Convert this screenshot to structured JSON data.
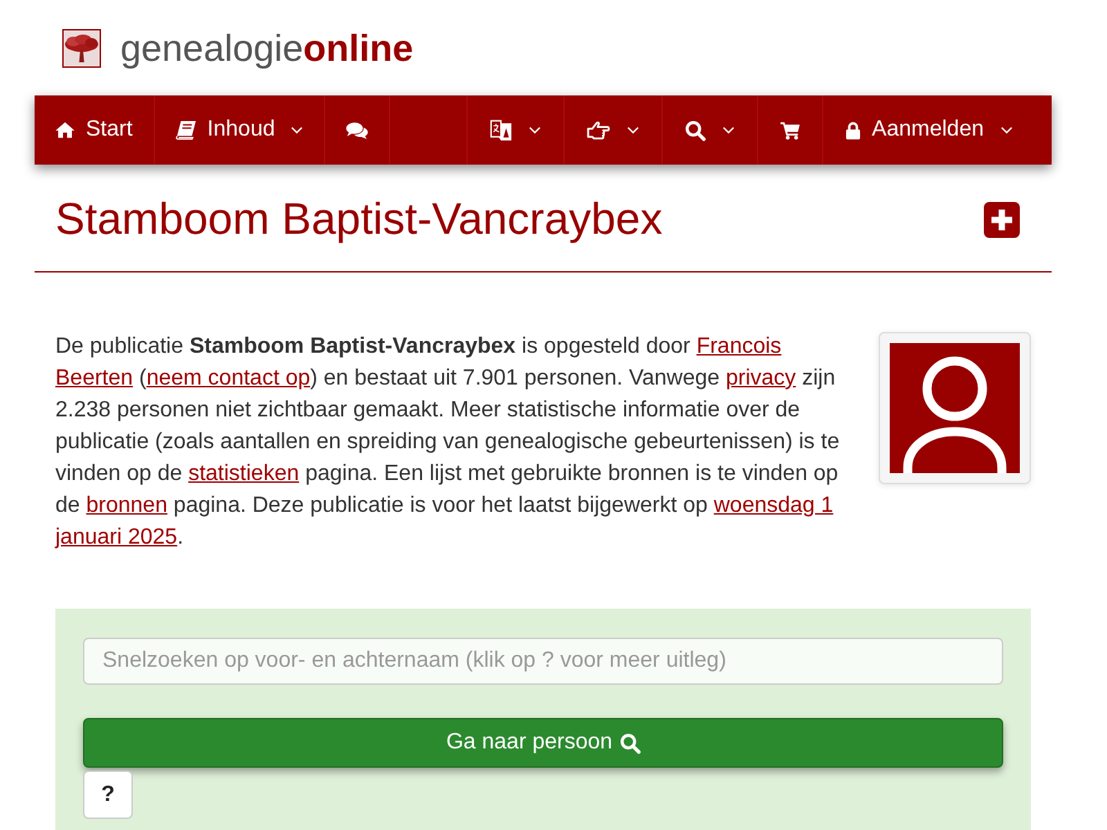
{
  "logo": {
    "text": "genealogie**online**"
  },
  "nav": {
    "left": [
      {
        "label": "Start",
        "dropdown": false
      },
      {
        "label": "Inhoud",
        "dropdown": true
      },
      {
        "dropdown": false
      }
    ],
    "right": [
      {
        "dropdown": true
      },
      {
        "dropdown": true
      },
      {
        "dropdown": true
      },
      {
        "dropdown": false
      },
      {
        "label": "Aanmelden",
        "dropdown": true
      }
    ]
  },
  "page": {
    "title": "Stamboom Baptist-Vancraybex"
  },
  "intro": [
    {
      "kind": "text",
      "text": "De publicatie **Stamboom Baptist-Vancraybex** is opgesteld door "
    },
    {
      "kind": "link",
      "lines": [
        "Francois",
        "Beerten"
      ]
    },
    {
      "kind": "text",
      "text": " ("
    },
    {
      "kind": "link",
      "lines": [
        "neem contact op"
      ]
    },
    {
      "kind": "text",
      "text": ") en bestaat uit 7.901 personen. Vanwege "
    },
    {
      "kind": "link",
      "lines": [
        "privacy"
      ]
    },
    {
      "kind": "text",
      "text": " zijn 2.238 personen niet zichtbaar gemaakt. Meer statistische informatie over de publicatie (zoals aantallen en spreiding van genealogische gebeurtenissen) is te vinden op de "
    },
    {
      "kind": "link",
      "lines": [
        "statistieken"
      ]
    },
    {
      "kind": "text",
      "text": " pagina. Een lijst met gebruikte bronnen is te vinden op de "
    },
    {
      "kind": "link",
      "lines": [
        "bronnen"
      ]
    },
    {
      "kind": "text",
      "text": " pagina. Deze publicatie is voor het laatst bijgewerkt op "
    },
    {
      "kind": "link",
      "lines": [
        "woensdag 1",
        "januari 2025"
      ]
    },
    {
      "kind": "text",
      "text": "."
    }
  ],
  "search": {
    "placeholder": "Snelzoeken op voor- en achternaam (klik op ? voor meer uitleg)",
    "button": "Ga naar persoon",
    "help": "?"
  }
}
